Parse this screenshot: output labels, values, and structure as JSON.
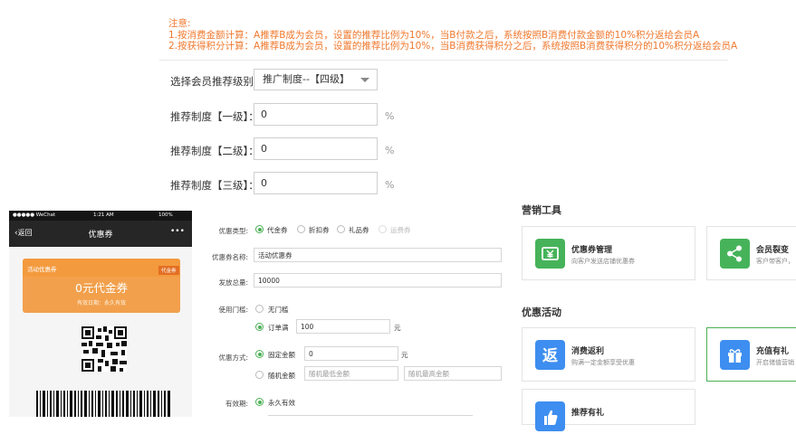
{
  "notice": {
    "title": "注意:",
    "line1": "1.按消费金额计算：A推荐B成为会员，设置的推荐比例为10%，当B付款之后，系统按照B消费付款金额的10%积分返给会员A",
    "line2": "2.按获得积分计算：A推荐B成为会员，设置的推荐比例为10%，当B消费获得积分之后，系统按照B消费获得积分的10%积分返给会员A"
  },
  "referral": {
    "level_label": "选择会员推荐级别：",
    "level_value": "推广制度--【四级】",
    "unit": "%",
    "levels": [
      {
        "label": "推荐制度【一级】：",
        "value": "0"
      },
      {
        "label": "推荐制度【二级】：",
        "value": "0"
      },
      {
        "label": "推荐制度【三级】：",
        "value": "0"
      }
    ]
  },
  "phone": {
    "carrier": "●●●●● WeChat",
    "time": "1:21 AM",
    "battery": "100%",
    "back_label": "返回",
    "title": "优惠券",
    "more": "•••",
    "coupon_tag": "活动优惠券",
    "coupon_badge": "代金券",
    "coupon_amount": "0元代金券",
    "coupon_validity": "有效日期：永久有效"
  },
  "coupon_form": {
    "type_label": "优惠类型:",
    "type_options": [
      "代金券",
      "折扣券",
      "礼品券",
      "运费券"
    ],
    "name_label": "优惠券名称:",
    "name_value": "活动优惠券",
    "total_label": "发放总量:",
    "total_value": "10000",
    "threshold_label": "使用门槛:",
    "threshold_none": "无门槛",
    "threshold_full": "订单满",
    "threshold_value": "100",
    "currency": "元",
    "method_label": "优惠方式:",
    "method_fixed": "固定金额",
    "method_fixed_value": "0",
    "method_random": "随机金额",
    "random_min_placeholder": "随机最低金额",
    "random_max_placeholder": "随机最高金额",
    "validity_label": "有效期:",
    "validity_value": "永久有效"
  },
  "marketing": {
    "tools_title": "营销工具",
    "activities_title": "优惠活动",
    "tools": [
      {
        "title": "优惠券管理",
        "desc": "向客户发送店铺优惠券",
        "icon": "yen-ticket-icon",
        "color": "#46b35a"
      },
      {
        "title": "会员裂变",
        "desc": "客户带客户，",
        "icon": "share-icon",
        "color": "#46b35a"
      }
    ],
    "activities": [
      {
        "title": "消费返利",
        "desc": "购满一定金额享受优惠",
        "icon": "rebate-icon",
        "color": "#3d8ef0"
      },
      {
        "title": "充值有礼",
        "desc": "开启储值营销",
        "icon": "gift-icon",
        "color": "#3d8ef0"
      },
      {
        "title": "推荐有礼",
        "desc": "",
        "icon": "thumb-icon",
        "color": "#3d8ef0"
      }
    ]
  }
}
